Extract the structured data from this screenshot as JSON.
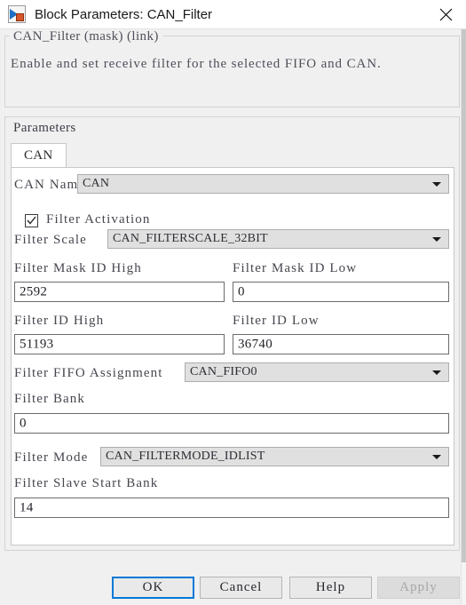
{
  "window": {
    "title": "Block Parameters: CAN_Filter",
    "icon": "simulink-block-icon",
    "close_icon": "close-icon"
  },
  "description": {
    "legend": "CAN_Filter (mask) (link)",
    "text": "Enable and set receive filter for the selected FIFO and CAN."
  },
  "parameters": {
    "legend": "Parameters",
    "tabs": [
      {
        "label": "CAN",
        "selected": true
      }
    ],
    "fields": {
      "can_name": {
        "label": "CAN Name",
        "value": "CAN",
        "type": "combobox"
      },
      "filter_activation": {
        "label": "Filter Activation",
        "checked": true,
        "type": "checkbox"
      },
      "filter_scale": {
        "label": "Filter Scale",
        "value": "CAN_FILTERSCALE_32BIT",
        "type": "combobox"
      },
      "filter_mask_id_high": {
        "label": "Filter Mask ID High",
        "value": "2592",
        "type": "textbox"
      },
      "filter_mask_id_low": {
        "label": "Filter Mask ID Low",
        "value": "0",
        "type": "textbox"
      },
      "filter_id_high": {
        "label": "Filter ID High",
        "value": "51193",
        "type": "textbox"
      },
      "filter_id_low": {
        "label": "Filter ID Low",
        "value": "36740",
        "type": "textbox"
      },
      "filter_fifo_assignment": {
        "label": "Filter FIFO Assignment",
        "value": "CAN_FIFO0",
        "type": "combobox"
      },
      "filter_bank": {
        "label": "Filter Bank",
        "value": "0",
        "type": "textbox"
      },
      "filter_mode": {
        "label": "Filter Mode",
        "value": "CAN_FILTERMODE_IDLIST",
        "type": "combobox"
      },
      "filter_slave_start_bank": {
        "label": "Filter Slave Start Bank",
        "value": "14",
        "type": "textbox"
      }
    }
  },
  "buttons": {
    "ok": "OK",
    "cancel": "Cancel",
    "help": "Help",
    "apply": "Apply",
    "apply_enabled": false,
    "ok_is_default": true
  },
  "colors": {
    "dialog_background": "#f0f0f0",
    "titlebar_background": "#ffffff",
    "panel_background": "#ffffff",
    "combo_background": "#e0e0e0",
    "textbox_background": "#ffffff",
    "label_text": "#46464f",
    "focus_accent": "#0078d7",
    "disabled_text": "#a6a6a6"
  }
}
